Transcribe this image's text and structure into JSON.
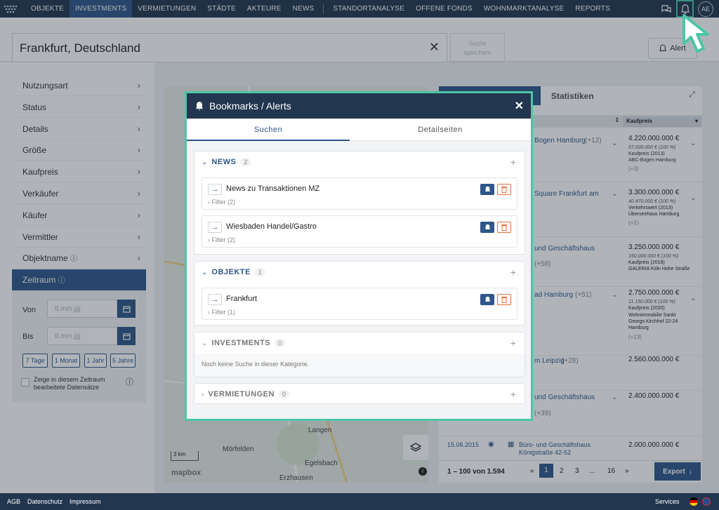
{
  "nav": {
    "items": [
      "OBJEKTE",
      "INVESTMENTS",
      "VERMIETUNGEN",
      "STÄDTE",
      "AKTEURE",
      "NEWS",
      "STANDORTANALYSE",
      "OFFENE FONDS",
      "WOHNMARKTANALYSE",
      "REPORTS"
    ],
    "active": "INVESTMENTS",
    "avatar": "AE"
  },
  "search": {
    "value": "Frankfurt, Deutschland",
    "save_label_1": "Suche",
    "save_label_2": "speichern",
    "alert_label": "Alert"
  },
  "sidebar": {
    "filters": [
      "Nutzungsart",
      "Status",
      "Details",
      "Größe",
      "Kaufpreis",
      "Verkäufer",
      "Käufer",
      "Vermittler",
      "Objektname"
    ],
    "zeitraum": "Zeitraum",
    "von_label": "Von",
    "bis_label": "Bis",
    "date_placeholder": "tt.mm.jjjj",
    "ranges": [
      "7 Tage",
      "1 Monat",
      "1 Jahr",
      "5 Jahre"
    ],
    "checkbox_label": "Zeige in diesem Zeitraum bearbeitete Datensätze"
  },
  "map": {
    "places": [
      "Langen",
      "Mörfelden",
      "Egelsbach",
      "Erzhausen"
    ],
    "scale": "3 km",
    "attribution": "mapbox"
  },
  "results": {
    "tab_statistiken": "Statistiken",
    "col_kaufpreis": "Kaufpreis",
    "rows": [
      {
        "name": "Bogen Hamburg",
        "extra": "(+12)",
        "price": "4.220.000.000 €",
        "detail": "67.000.000 € (100 %)",
        "type": "Kaufpreis (2013)",
        "obj": "ABC-Bogen Hamburg",
        "more": "(+3)"
      },
      {
        "name": "Square Frankfurt am",
        "extra": "",
        "price": "3.300.000.000 €",
        "detail": "40.470.000 € (100 %)",
        "type": "Verkehrswert (2013)",
        "obj": "Überseehaus Hamburg",
        "more": "(+1)"
      },
      {
        "name": "und Geschäftshaus",
        "extra": "(+58)",
        "price": "3.250.000.000 €",
        "detail": "150.000.000 € (100 %)",
        "type": "Kaufpreis (2018)",
        "obj": "GALERIA Köln Hohe Straße",
        "more": ""
      },
      {
        "name": "ad Hamburg",
        "extra": "(+51)",
        "price": "2.750.000.000 €",
        "detail": "11.150.000 € (100 %)",
        "type": "Kaufpreis (2020)",
        "obj": "Wohnimmobilie Sankt Georgs Kirchhof 22-24 Hamburg",
        "more": "(+13)"
      },
      {
        "name": "m Leipzig",
        "extra": "(+28)",
        "price": "2.560.000.000 €",
        "detail": "",
        "type": "",
        "obj": "",
        "more": ""
      },
      {
        "name": "und Geschäftshaus",
        "extra": "(+39)",
        "price": "2.400.000.000 €",
        "detail": "",
        "type": "",
        "obj": "",
        "more": ""
      },
      {
        "name": "Büro- und Geschäftshaus Königstraße 42-52",
        "extra": "",
        "price": "2.000.000.000 €",
        "detail": "",
        "type": "",
        "obj": "",
        "more": "",
        "date": "15.06.2015"
      }
    ],
    "range": "1 – 100 von 1.594",
    "pages": [
      "«",
      "1",
      "2",
      "3",
      "...",
      "16",
      "»"
    ],
    "export_label": "Export"
  },
  "modal": {
    "title": "Bookmarks / Alerts",
    "tab_suchen": "Suchen",
    "tab_detail": "Detailseiten",
    "sections": [
      {
        "title": "NEWS",
        "count": "2",
        "cards": [
          {
            "title": "News zu Transaktionen MZ",
            "filter": "Filter (2)"
          },
          {
            "title": "Wiesbaden Handel/Gastro",
            "filter": "Filter (2)"
          }
        ]
      },
      {
        "title": "OBJEKTE",
        "count": "1",
        "cards": [
          {
            "title": "Frankfurt",
            "filter": "Filter (1)"
          }
        ]
      },
      {
        "title": "INVESTMENTS",
        "count": "0",
        "empty": "Noch keine Suche in dieser Kategorie."
      },
      {
        "title": "VERMIETUNGEN",
        "count": "0"
      }
    ]
  },
  "footer": {
    "links": [
      "AGB",
      "Datenschutz",
      "Impressum"
    ],
    "services": "Services"
  },
  "colors": {
    "navy": "#22364f",
    "blue": "#2e5688",
    "accent": "#4bc6a6",
    "danger": "#e0703f"
  }
}
